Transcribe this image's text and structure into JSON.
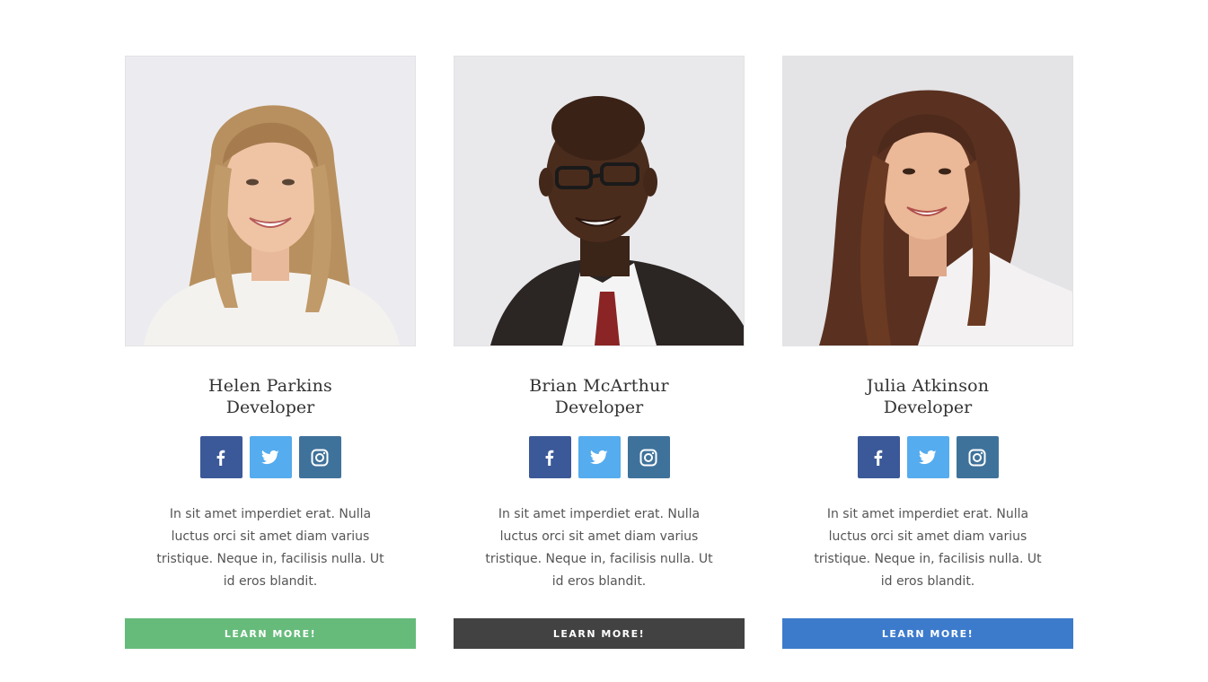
{
  "team": {
    "members": [
      {
        "name": "Helen Parkins",
        "role": "Developer",
        "bio": "In sit amet imperdiet erat. Nulla luctus orci sit amet diam varius tristique. Neque in, facilisis nulla. Ut id eros blandit.",
        "button_label": "LEARN MORE!",
        "button_color": "#66bb7a",
        "photo_icon": "portrait-photo"
      },
      {
        "name": "Brian McArthur",
        "role": "Developer",
        "bio": "In sit amet imperdiet erat. Nulla luctus orci sit amet diam varius tristique. Neque in, facilisis nulla. Ut id eros blandit.",
        "button_label": "LEARN MORE!",
        "button_color": "#424242",
        "photo_icon": "portrait-photo"
      },
      {
        "name": "Julia Atkinson",
        "role": "Developer",
        "bio": "In sit amet imperdiet erat. Nulla luctus orci sit amet diam varius tristique. Neque in, facilisis nulla. Ut id eros blandit.",
        "button_label": "LEARN MORE!",
        "button_color": "#3c7bcc",
        "photo_icon": "portrait-photo"
      }
    ],
    "socials": [
      {
        "icon": "facebook-icon",
        "color": "#3b5998"
      },
      {
        "icon": "twitter-icon",
        "color": "#55acee"
      },
      {
        "icon": "instagram-icon",
        "color": "#3f729b"
      }
    ]
  }
}
